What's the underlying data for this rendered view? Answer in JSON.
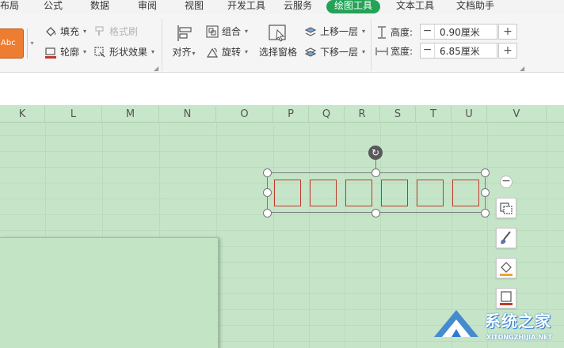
{
  "menu": {
    "tabs": [
      {
        "label": "布局"
      },
      {
        "label": "公式"
      },
      {
        "label": "数据"
      },
      {
        "label": "审阅"
      },
      {
        "label": "视图"
      },
      {
        "label": "开发工具"
      },
      {
        "label": "云服务"
      },
      {
        "label": "绘图工具",
        "active": true
      },
      {
        "label": "文本工具"
      },
      {
        "label": "文档助手"
      }
    ]
  },
  "ribbon": {
    "style_swatch_label": "Abc",
    "fill": "填充",
    "format_painter": "格式刷",
    "outline": "轮廓",
    "shape_effects": "形状效果",
    "align": "对齐",
    "group": "组合",
    "rotate": "旋转",
    "selection_pane": "选择窗格",
    "bring_forward": "上移一层",
    "send_backward": "下移一层",
    "height_label": "高度:",
    "height_value": "0.90厘米",
    "width_label": "宽度:",
    "width_value": "6.85厘米"
  },
  "columns": [
    "K",
    "L",
    "M",
    "N",
    "O",
    "P",
    "Q",
    "R",
    "S",
    "T",
    "U",
    "V"
  ],
  "watermark": {
    "text": "系统之家",
    "url": "XITONGZHIJIA.NET"
  },
  "colors": {
    "sheet_bg": "#c6e5c8",
    "active_tab": "#24a358",
    "shape_outline": "#c0392b",
    "style_swatch": "#ed7d31"
  }
}
